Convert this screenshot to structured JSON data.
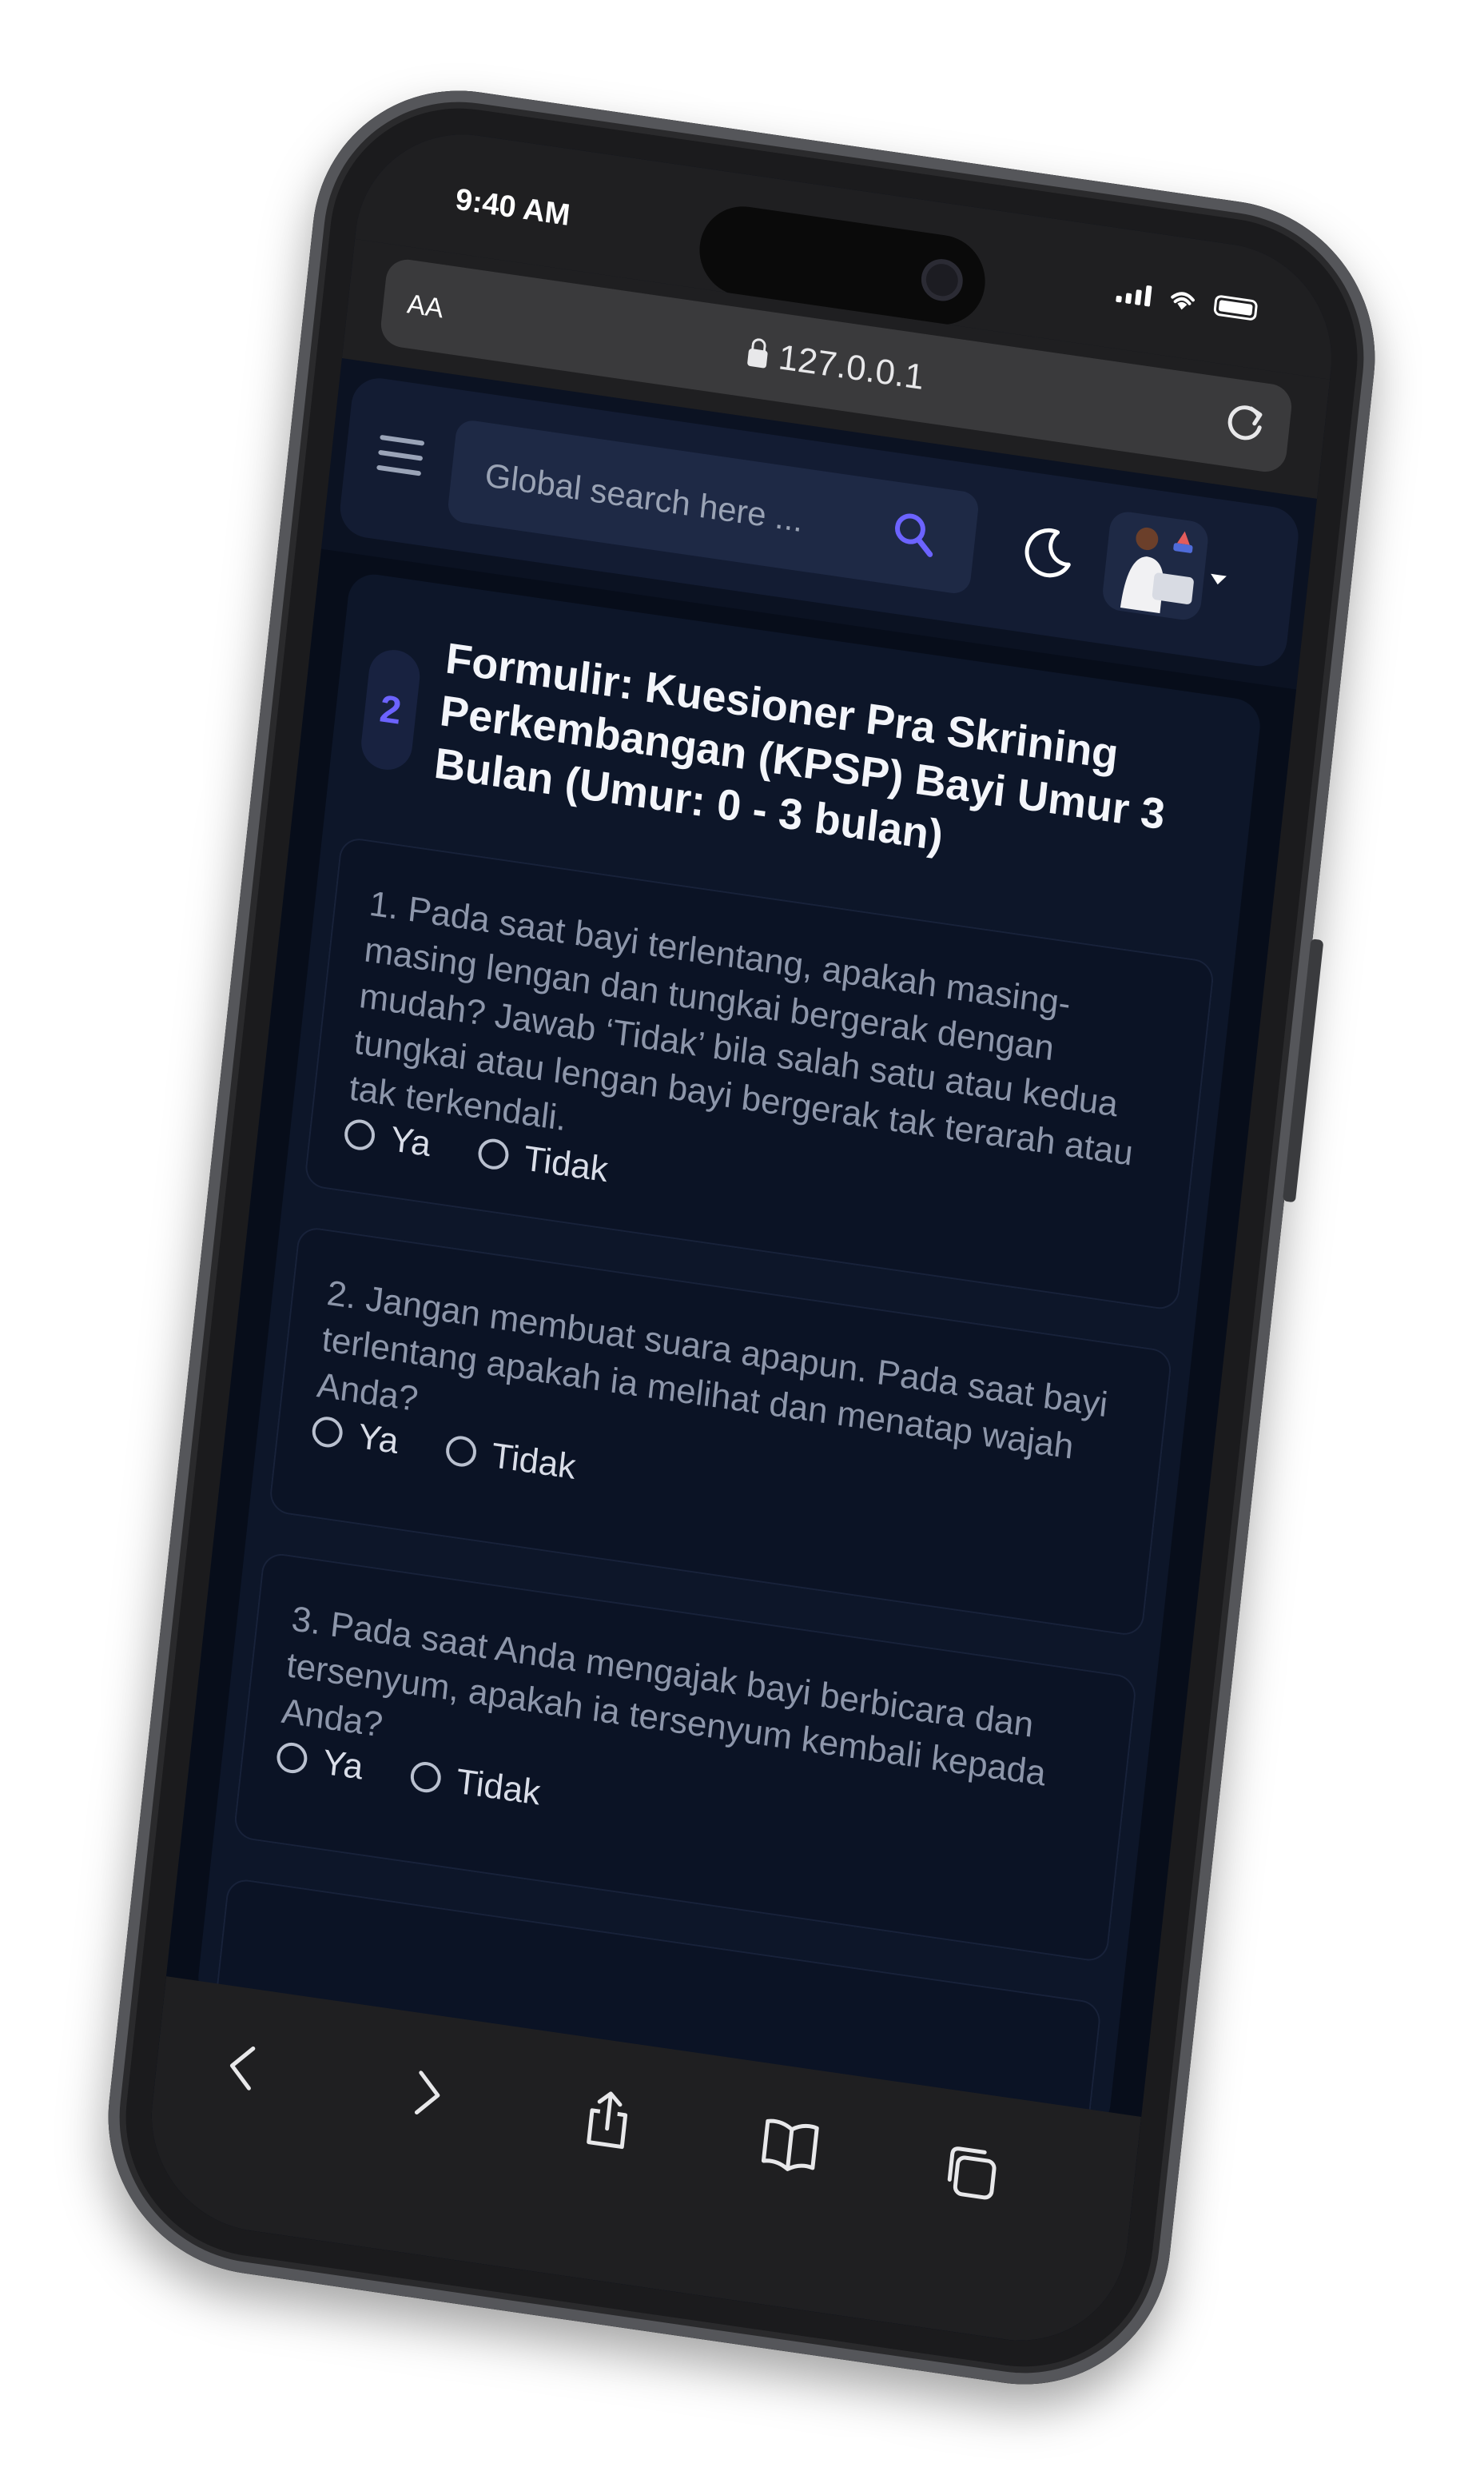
{
  "status_bar": {
    "time": "9:40 AM"
  },
  "browser": {
    "text_size_label": "AA",
    "url": "127.0.0.1"
  },
  "header": {
    "search_placeholder": "Global search here ..."
  },
  "form": {
    "step": "2",
    "title": "Formulir: Kuesioner Pra Skrining Perkembangan (KPSP) Bayi Umur 3 Bulan (Umur: 0 - 3 bulan)",
    "questions": [
      {
        "text": "1. Pada saat bayi terlentang, apakah masing-masing lengan dan tungkai bergerak dengan mudah? Jawab ‘Tidak’ bila salah satu atau kedua tungkai atau lengan bayi bergerak tak terarah atau tak terkendali.",
        "option_yes": "Ya",
        "option_no": "Tidak"
      },
      {
        "text": "2. Jangan membuat suara apapun. Pada saat bayi terlentang apakah ia melihat dan menatap wajah Anda?",
        "option_yes": "Ya",
        "option_no": "Tidak"
      },
      {
        "text": "3. Pada saat Anda mengajak bayi berbicara dan tersenyum, apakah ia tersenyum kembali kepada Anda?",
        "option_yes": "Ya",
        "option_no": "Tidak"
      }
    ]
  },
  "colors": {
    "accent": "#6c63ff",
    "screen_bg": "#0b1222",
    "card_bg": "#0d1629"
  },
  "icons": {
    "menu": "hamburger-icon",
    "search": "search-icon",
    "theme": "moon-icon",
    "back": "chevron-left-icon",
    "forward": "chevron-right-icon",
    "share": "share-icon",
    "bookmarks": "book-icon",
    "tabs": "tabs-icon"
  }
}
